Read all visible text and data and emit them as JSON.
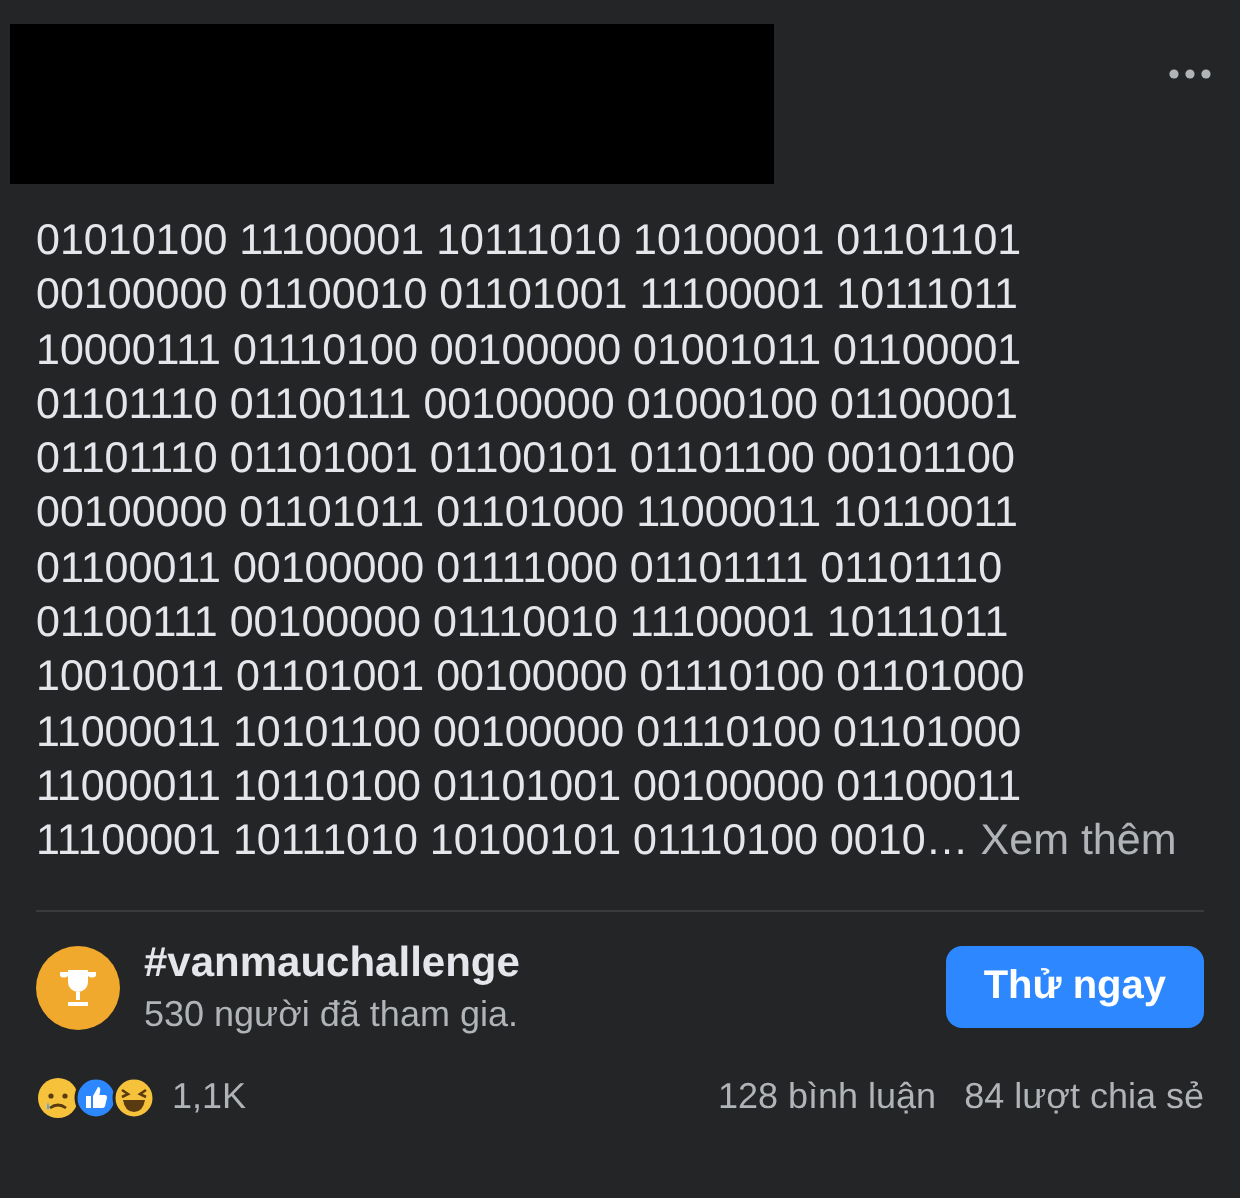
{
  "post": {
    "body_lines": [
      "01010100 11100001 10111010 10100001 01101101",
      "00100000 01100010 01101001 11100001 10111011",
      "10000111 01110100 00100000 01001011 01100001",
      "01101110 01100111 00100000 01000100 01100001",
      "01101110 01101001 01100101 01101100 00101100",
      "00100000 01101011 01101000 11000011 10110011",
      "01100011 00100000 01111000 01101111 01101110",
      "01100111 00100000 01110010 11100001 10111011",
      "10010011 01101001 00100000 01110100 01101000",
      "11000011 10101100 00100000 01110100 01101000",
      "11000011 10110100 01101001 00100000 01100011",
      "11100001 10111010 10100101 01110100 0010…"
    ],
    "see_more": "Xem thêm"
  },
  "challenge": {
    "tag": "#vanmauchallenge",
    "participants": "530 người đã tham gia.",
    "button": "Thử ngay"
  },
  "footer": {
    "reaction_count": "1,1K",
    "comments": "128 bình luận",
    "shares": "84 lượt chia sẻ"
  }
}
